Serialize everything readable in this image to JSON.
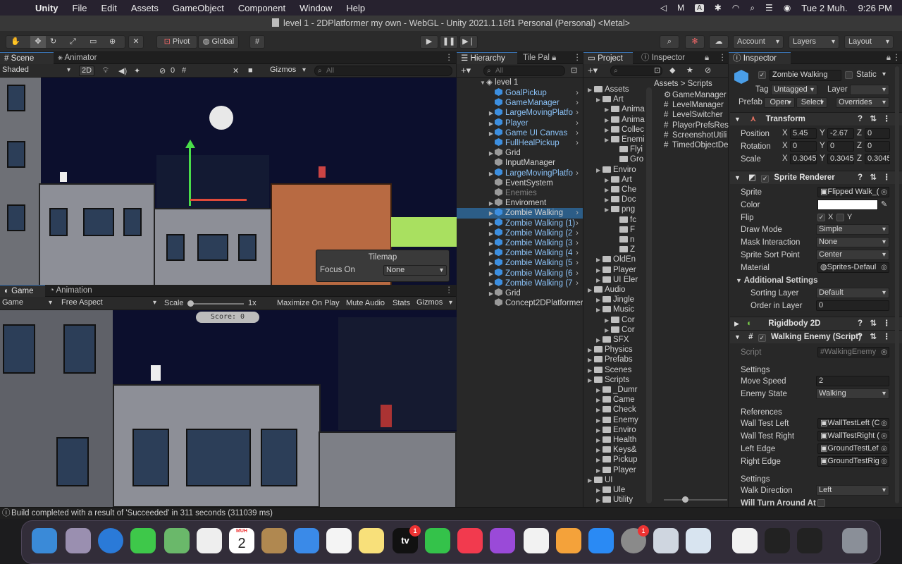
{
  "menubar": {
    "app": "Unity",
    "items": [
      "File",
      "Edit",
      "Assets",
      "GameObject",
      "Component",
      "Window",
      "Help"
    ],
    "date": "Tue 2 Muh.",
    "time": "9:26 PM"
  },
  "window": {
    "title": "level 1 - 2DPlatformer my own - WebGL - Unity 2021.1.16f1 Personal (Personal) <Metal>"
  },
  "toolbar": {
    "pivot": "Pivot",
    "global": "Global",
    "account": "Account",
    "layers": "Layers",
    "layout": "Layout"
  },
  "scene": {
    "tab_scene": "Scene",
    "tab_animator": "Animator",
    "shading": "Shaded",
    "mode2d": "2D",
    "hidden_count": "0",
    "gizmos": "Gizmos",
    "search": "All",
    "tilemap": {
      "title": "Tilemap",
      "focus_label": "Focus On",
      "focus_value": "None"
    }
  },
  "game": {
    "tab_game": "Game",
    "tab_animation": "Animation",
    "display": "Game",
    "aspect": "Free Aspect",
    "scale_label": "Scale",
    "scale_value": "1x",
    "maximize": "Maximize On Play",
    "mute": "Mute Audio",
    "stats": "Stats",
    "gizmos": "Gizmos",
    "score": "Score: 0"
  },
  "hierarchy": {
    "tab": "Hierarchy",
    "tab2": "Tile Pal",
    "search": "All",
    "scene": "level 1",
    "items": [
      {
        "label": "GoalPickup",
        "blue": true,
        "arrow": true
      },
      {
        "label": "GameManager",
        "blue": true,
        "arrow": true
      },
      {
        "label": "LargeMovingPlatfo",
        "blue": true,
        "arrow": true,
        "expand": true
      },
      {
        "label": "Player",
        "blue": true,
        "arrow": true,
        "expand": true
      },
      {
        "label": "Game UI Canvas",
        "blue": true,
        "arrow": true,
        "expand": true
      },
      {
        "label": "FullHealPickup",
        "blue": true,
        "arrow": true
      },
      {
        "label": "Grid",
        "blue": false,
        "expand": true
      },
      {
        "label": "InputManager",
        "blue": false
      },
      {
        "label": "LargeMovingPlatfo",
        "blue": true,
        "arrow": true,
        "expand": true
      },
      {
        "label": "EventSystem",
        "blue": false
      },
      {
        "label": "Enemies",
        "blue": false,
        "dim": true
      },
      {
        "label": "Enviroment",
        "blue": false,
        "expand": true
      },
      {
        "label": "Zombie Walking",
        "blue": true,
        "arrow": true,
        "expand": true,
        "selected": true
      },
      {
        "label": "Zombie Walking (1)",
        "blue": true,
        "arrow": true,
        "expand": true
      },
      {
        "label": "Zombie Walking (2",
        "blue": true,
        "arrow": true,
        "expand": true
      },
      {
        "label": "Zombie Walking (3",
        "blue": true,
        "arrow": true,
        "expand": true
      },
      {
        "label": "Zombie Walking (4",
        "blue": true,
        "arrow": true,
        "expand": true
      },
      {
        "label": "Zombie Walking (5",
        "blue": true,
        "arrow": true,
        "expand": true
      },
      {
        "label": "Zombie Walking (6",
        "blue": true,
        "arrow": true,
        "expand": true
      },
      {
        "label": "Zombie Walking (7",
        "blue": true,
        "arrow": true,
        "expand": true
      },
      {
        "label": "Grid",
        "blue": false,
        "expand": true
      },
      {
        "label": "Concept2DPlatformer",
        "blue": false
      }
    ]
  },
  "project": {
    "tab": "Project",
    "tab2": "Inspector",
    "breadcrumb_root": "Assets",
    "breadcrumb_child": "Scripts",
    "tree": [
      {
        "label": "Assets",
        "depth": 0
      },
      {
        "label": "Art",
        "depth": 1
      },
      {
        "label": "Anima",
        "depth": 2
      },
      {
        "label": "Anima",
        "depth": 2
      },
      {
        "label": "Collec",
        "depth": 2
      },
      {
        "label": "Enemi",
        "depth": 2
      },
      {
        "label": "Flyi",
        "depth": 3
      },
      {
        "label": "Gro",
        "depth": 3
      },
      {
        "label": "Enviro",
        "depth": 1
      },
      {
        "label": "Art",
        "depth": 2
      },
      {
        "label": "Che",
        "depth": 2
      },
      {
        "label": "Doc",
        "depth": 2
      },
      {
        "label": "png",
        "depth": 2
      },
      {
        "label": "fc",
        "depth": 3
      },
      {
        "label": "F",
        "depth": 3
      },
      {
        "label": "n",
        "depth": 3
      },
      {
        "label": "Z",
        "depth": 3
      },
      {
        "label": "OldEn",
        "depth": 1
      },
      {
        "label": "Player",
        "depth": 1
      },
      {
        "label": "UI Eler",
        "depth": 1
      },
      {
        "label": "Audio",
        "depth": 0
      },
      {
        "label": "Jingle",
        "depth": 1
      },
      {
        "label": "Music",
        "depth": 1
      },
      {
        "label": "Cor",
        "depth": 2
      },
      {
        "label": "Cor",
        "depth": 2
      },
      {
        "label": "SFX",
        "depth": 1
      },
      {
        "label": "Physics",
        "depth": 0
      },
      {
        "label": "Prefabs",
        "depth": 0
      },
      {
        "label": "Scenes",
        "depth": 0
      },
      {
        "label": "Scripts",
        "depth": 0
      },
      {
        "label": "_Dumr",
        "depth": 1
      },
      {
        "label": "Came",
        "depth": 1
      },
      {
        "label": "Check",
        "depth": 1
      },
      {
        "label": "Enemy",
        "depth": 1
      },
      {
        "label": "Enviro",
        "depth": 1
      },
      {
        "label": "Health",
        "depth": 1
      },
      {
        "label": "Keys&",
        "depth": 1
      },
      {
        "label": "Pickup",
        "depth": 1
      },
      {
        "label": "Player",
        "depth": 1
      },
      {
        "label": "UI",
        "depth": 0
      },
      {
        "label": "Ule",
        "depth": 1
      },
      {
        "label": "Utility",
        "depth": 1
      }
    ],
    "files": [
      "GameManager",
      "LevelManager",
      "LevelSwitcher",
      "PlayerPrefsRes",
      "ScreenshotUtili",
      "TimedObjectDe"
    ]
  },
  "inspector": {
    "tab": "Inspector",
    "object_name": "Zombie Walking",
    "static": "Static",
    "tag_label": "Tag",
    "tag": "Untagged",
    "layer_label": "Layer",
    "prefab_label": "Prefab",
    "open": "Open",
    "select": "Select",
    "overrides": "Overrides",
    "transform": {
      "title": "Transform",
      "position_label": "Position",
      "rotation_label": "Rotation",
      "scale_label": "Scale",
      "pos": [
        "5.45",
        "-2.67",
        "0"
      ],
      "rot": [
        "0",
        "0",
        "0"
      ],
      "scale": [
        "0.3045",
        "0.3045",
        "0.3045"
      ]
    },
    "sprite_renderer": {
      "title": "Sprite Renderer",
      "sprite_label": "Sprite",
      "sprite": "Flipped Walk_(",
      "color_label": "Color",
      "flip_label": "Flip",
      "flip_x": "X",
      "flip_y": "Y",
      "draw_mode_label": "Draw Mode",
      "draw_mode": "Simple",
      "mask_label": "Mask Interaction",
      "mask": "None",
      "sort_point_label": "Sprite Sort Point",
      "sort_point": "Center",
      "material_label": "Material",
      "material": "Sprites-Defaul",
      "additional": "Additional Settings",
      "sorting_layer_label": "Sorting Layer",
      "sorting_layer": "Default",
      "order_label": "Order in Layer",
      "order": "0"
    },
    "rigidbody": {
      "title": "Rigidbody 2D"
    },
    "walking_enemy": {
      "title": "Walking Enemy (Script)",
      "script_label": "Script",
      "script": "WalkingEnemy",
      "settings": "Settings",
      "move_speed_label": "Move Speed",
      "move_speed": "2",
      "enemy_state_label": "Enemy State",
      "enemy_state": "Walking",
      "references": "References",
      "wall_left_label": "Wall Test Left",
      "wall_left": "WallTestLeft (C",
      "wall_right_label": "Wall Test Right",
      "wall_right": "WallTestRight (",
      "left_edge_label": "Left Edge",
      "left_edge": "GroundTestLef",
      "right_edge_label": "Right Edge",
      "right_edge": "GroundTestRig",
      "settings2": "Settings",
      "walk_dir_label": "Walk Direction",
      "walk_dir": "Left",
      "turn_label": "Will Turn Around At E"
    }
  },
  "status": {
    "message": "Build completed with a result of 'Succeeded' in 311 seconds (311039 ms)"
  },
  "dock": {
    "calendar_month": "MUH",
    "calendar_day": "2",
    "tv_label": "tv",
    "badge_tv": "1",
    "badge_settings": "1"
  }
}
